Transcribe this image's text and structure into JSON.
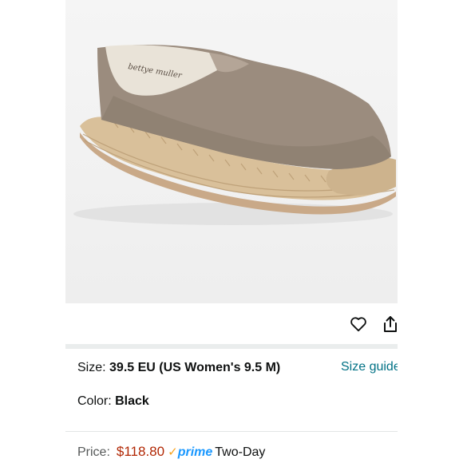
{
  "product": {
    "image_alt": "Espadrille slip-on shoe",
    "insole_brand_text": "bettye muller"
  },
  "actions": {
    "favorite_icon": "heart-icon",
    "share_icon": "share-icon"
  },
  "size": {
    "label": "Size: ",
    "value": "39.5 EU (US Women's 9.5 M)",
    "guide_label": "Size guide"
  },
  "color": {
    "label": "Color: ",
    "value": "Black"
  },
  "price": {
    "label": "Price:",
    "value": "$118.80",
    "prime_check": "✓",
    "prime_word": "prime",
    "delivery": "Two-Day"
  },
  "colors": {
    "price": "#b12704",
    "link": "#007185",
    "prime": "#1a98ff"
  }
}
